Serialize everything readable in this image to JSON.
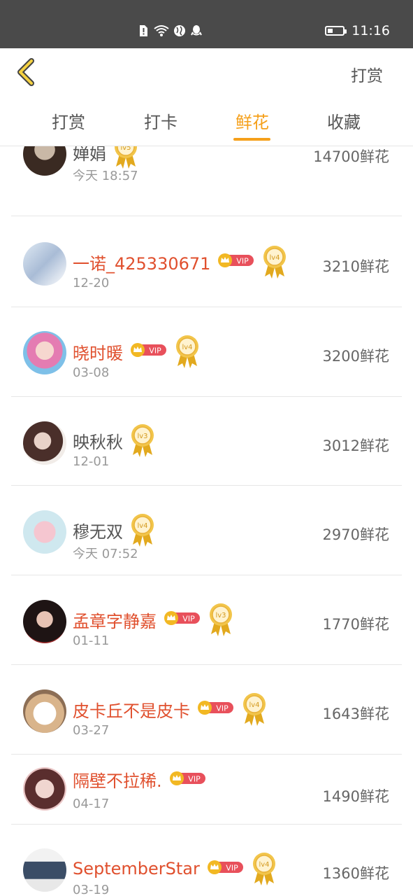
{
  "status_bar": {
    "time": "11:16",
    "battery_level": 0.35
  },
  "header": {
    "right_link": "打赏",
    "tabs": [
      {
        "label": "打赏",
        "active": false
      },
      {
        "label": "打卡",
        "active": false
      },
      {
        "label": "鲜花",
        "active": true
      },
      {
        "label": "收藏",
        "active": false
      }
    ]
  },
  "colors": {
    "accent": "#f5a01b",
    "vip_name": "#e0502e",
    "vip_badge": "#e8505b",
    "crown": "#f2b823"
  },
  "list": [
    {
      "name": "婵娟",
      "vip": false,
      "level": "lv5",
      "date": "今天 18:57",
      "amount": "14700鲜花"
    },
    {
      "name": "一诺_425330671",
      "vip": true,
      "level": "lv4",
      "date": "12-20",
      "amount": "3210鲜花"
    },
    {
      "name": "晓时暖",
      "vip": true,
      "level": "lv4",
      "date": "03-08",
      "amount": "3200鲜花"
    },
    {
      "name": "映秋秋",
      "vip": false,
      "level": "lv3",
      "date": "12-01",
      "amount": "3012鲜花"
    },
    {
      "name": "穆无双",
      "vip": false,
      "level": "lv4",
      "date": "今天 07:52",
      "amount": "2970鲜花"
    },
    {
      "name": "孟章字静嘉",
      "vip": true,
      "level": "lv3",
      "date": "01-11",
      "amount": "1770鲜花"
    },
    {
      "name": "皮卡丘不是皮卡",
      "vip": true,
      "level": "lv4",
      "date": "03-27",
      "amount": "1643鲜花"
    },
    {
      "name": "隔壁不拉稀.",
      "vip": true,
      "level": "",
      "date": "04-17",
      "amount": "1490鲜花"
    },
    {
      "name": "SeptemberStar",
      "vip": true,
      "level": "lv4",
      "date": "03-19",
      "amount": "1360鲜花"
    }
  ],
  "vip_label": "VIP"
}
